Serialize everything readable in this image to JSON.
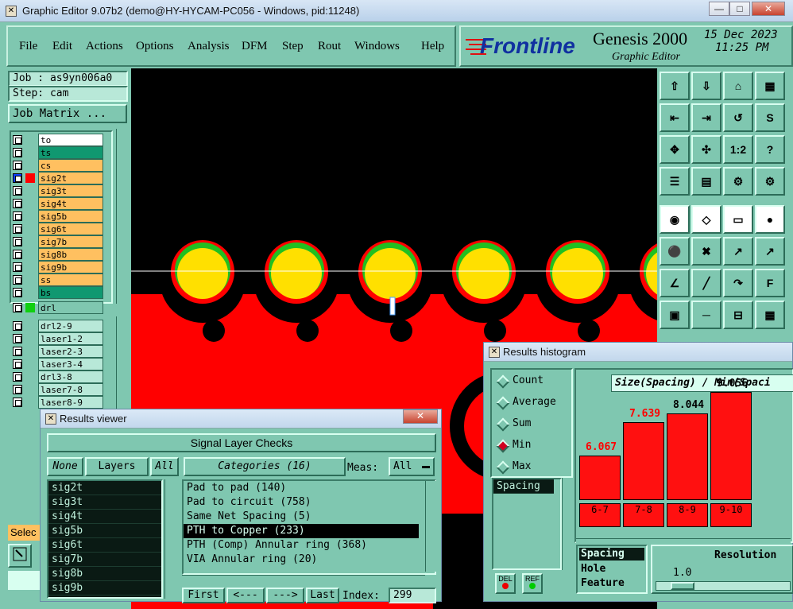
{
  "window": {
    "title": "Graphic Editor 9.07b2 (demo@HY-HYCAM-PC056 - Windows, pid:11248)",
    "min": "—",
    "max": "□",
    "close": "✕"
  },
  "menu": [
    "File",
    "Edit",
    "Actions",
    "Options",
    "Analysis",
    "DFM",
    "Step",
    "Rout",
    "Windows",
    "Help"
  ],
  "brand": {
    "logo": "Frontline",
    "product": "Genesis 2000",
    "subtitle": "Graphic Editor",
    "date": "15 Dec 2023",
    "time": "11:25 PM"
  },
  "job": {
    "job_label": "Job : as9yn006a0",
    "step_label": "Step: cam",
    "matrix_button": "Job Matrix ..."
  },
  "layers": [
    {
      "name": "to",
      "color": "#ffffff"
    },
    {
      "name": "ts",
      "color": "#109870"
    },
    {
      "name": "cs",
      "color": "#ffc060"
    },
    {
      "name": "sig2t",
      "color": "#ffc060",
      "active": true
    },
    {
      "name": "sig3t",
      "color": "#ffc060"
    },
    {
      "name": "sig4t",
      "color": "#ffc060"
    },
    {
      "name": "sig5b",
      "color": "#ffc060"
    },
    {
      "name": "sig6t",
      "color": "#ffc060"
    },
    {
      "name": "sig7b",
      "color": "#ffc060"
    },
    {
      "name": "sig8b",
      "color": "#ffc060"
    },
    {
      "name": "sig9b",
      "color": "#ffc060"
    },
    {
      "name": "ss",
      "color": "#ffc060"
    },
    {
      "name": "bs",
      "color": "#109870"
    }
  ],
  "drill_layer": "drl",
  "drill_layers": [
    "drl2-9",
    "laser1-2",
    "laser2-3",
    "laser3-4",
    "drl3-8",
    "laser7-8",
    "laser8-9"
  ],
  "select_label": "Selec",
  "results_viewer": {
    "title": "Results viewer",
    "header": "Signal Layer Checks",
    "none_btn": "None",
    "layers_label": "Layers",
    "all_btn": "All",
    "categories_label": "Categories (16)",
    "meas_label": "Meas:",
    "meas_value": "All",
    "layer_list": [
      "sig2t",
      "sig3t",
      "sig4t",
      "sig5b",
      "sig6t",
      "sig7b",
      "sig8b",
      "sig9b"
    ],
    "categories": [
      "Pad to pad (140)",
      "Pad to circuit (758)",
      "Same Net Spacing (5)",
      "PTH to Copper (233)",
      "PTH (Comp) Annular ring (368)",
      "VIA Annular ring (20)"
    ],
    "nav": {
      "first": "First",
      "prev": "<---",
      "next": "--->",
      "last": "Last",
      "index_label": "Index:",
      "index_value": "299"
    }
  },
  "histogram": {
    "title": "Results histogram",
    "options": [
      "Count",
      "Average",
      "Sum",
      "Min",
      "Max"
    ],
    "selected_option": "Min",
    "measure_list": [
      "Spacing"
    ],
    "chart_title": "Size(Spacing) / Min(Spaci",
    "resolution_label": "Resolution",
    "resolution_value": "1.0",
    "axis_list": [
      "Spacing",
      "Hole",
      "Feature"
    ],
    "del_label": "DEL",
    "ref_label": "REF"
  },
  "chart_data": {
    "type": "bar",
    "title": "Size(Spacing) / Min(Spaci",
    "categories": [
      "6-7",
      "7-8",
      "8-9",
      "9-10"
    ],
    "values": [
      6.067,
      7.639,
      8.044,
      9.056
    ],
    "colors": {
      "bar": "#ff1010",
      "label_red": "#ff0000",
      "label_black": "#000000"
    }
  }
}
